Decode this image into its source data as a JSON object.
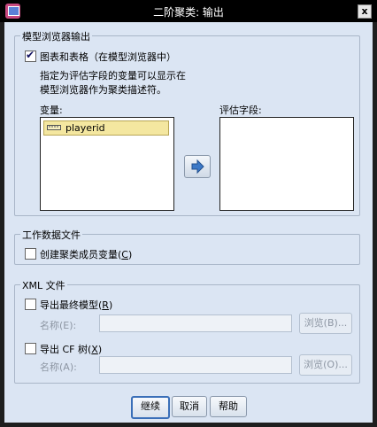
{
  "window": {
    "title": "二阶聚类: 输出",
    "close_glyph": "x"
  },
  "model_viewer_group": {
    "legend": "模型浏览器输出",
    "charts_checkbox": {
      "label": "图表和表格（在模型浏览器中）",
      "checked": true
    },
    "hint_line1": "指定为评估字段的变量可以显示在",
    "hint_line2": "模型浏览器作为聚类描述符。",
    "variables_label": "变量:",
    "variables": [
      "playerid"
    ],
    "eval_fields_label": "评估字段:"
  },
  "working_data_group": {
    "legend": "工作数据文件",
    "create_var_checkbox": {
      "label": "创建聚类成员变量(",
      "mnemonic": "C",
      "suffix": ")",
      "checked": false
    }
  },
  "xml_group": {
    "legend": "XML 文件",
    "export_final_model": {
      "label": "导出最终模型(",
      "mnemonic": "R",
      "suffix": ")",
      "checked": false
    },
    "name_label_1": "名称(E):",
    "browse_1": "浏览(B)...",
    "export_cf_tree": {
      "label": "导出 CF 树(",
      "mnemonic": "X",
      "suffix": ")",
      "checked": false
    },
    "name_label_2": "名称(A):",
    "browse_2": "浏览(O)..."
  },
  "buttons": {
    "continue": "继续",
    "cancel": "取消",
    "help": "帮助"
  }
}
